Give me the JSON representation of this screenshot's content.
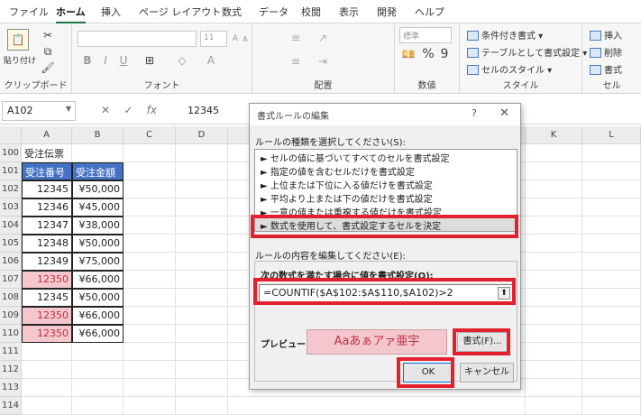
{
  "ribbon": {
    "tabs": [
      "ファイル",
      "ホーム",
      "挿入",
      "ページ レイアウト",
      "数式",
      "データ",
      "校閲",
      "表示",
      "開発",
      "ヘルプ"
    ],
    "clipboard": {
      "paste": "貼り付け",
      "label": "クリップボード"
    },
    "font": {
      "size": "11",
      "label": "フォント"
    },
    "alignment": {
      "label": "配置"
    },
    "number": {
      "format": "標準",
      "label": "数値"
    },
    "styles": {
      "conditional": "条件付き書式",
      "table": "テーブルとして書式設定",
      "cell": "セルのスタイル",
      "label": "スタイル"
    },
    "cells": {
      "insert": "挿入",
      "delete": "削除",
      "format": "書式",
      "label": "セル"
    }
  },
  "formula_bar": {
    "name_box": "A102",
    "value": "12345",
    "fx": "fx"
  },
  "grid": {
    "columns": [
      "A",
      "B",
      "C",
      "D",
      "K",
      "L"
    ],
    "rows": [
      {
        "num": "100",
        "a": "受注伝票",
        "b": ""
      },
      {
        "num": "101",
        "a": "受注番号",
        "b": "受注金額"
      },
      {
        "num": "102",
        "a": "12345",
        "b": "¥50,000"
      },
      {
        "num": "103",
        "a": "12346",
        "b": "¥45,000"
      },
      {
        "num": "104",
        "a": "12347",
        "b": "¥38,000"
      },
      {
        "num": "105",
        "a": "12348",
        "b": "¥50,000"
      },
      {
        "num": "106",
        "a": "12349",
        "b": "¥75,000"
      },
      {
        "num": "107",
        "a": "12350",
        "b": "¥66,000"
      },
      {
        "num": "108",
        "a": "12345",
        "b": "¥50,000"
      },
      {
        "num": "109",
        "a": "12350",
        "b": "¥66,000"
      },
      {
        "num": "110",
        "a": "12350",
        "b": "¥66,000"
      },
      {
        "num": "111",
        "a": "",
        "b": ""
      },
      {
        "num": "112",
        "a": "",
        "b": ""
      },
      {
        "num": "113",
        "a": "",
        "b": ""
      },
      {
        "num": "114",
        "a": "",
        "b": ""
      }
    ]
  },
  "dialog": {
    "title": "書式ルールの編集",
    "help": "?",
    "close": "✕",
    "rule_type_label": "ルールの種類を選択してください(S):",
    "rule_types": [
      "► セルの値に基づいてすべてのセルを書式設定",
      "► 指定の値を含むセルだけを書式設定",
      "► 上位または下位に入る値だけを書式設定",
      "► 平均より上または下の値だけを書式設定",
      "► 一意の値または重複する値だけを書式設定",
      "► 数式を使用して、書式設定するセルを決定"
    ],
    "edit_label": "ルールの内容を編集してください(E):",
    "formula_label": "次の数式を満たす場合に値を書式設定(O):",
    "formula": "=COUNTIF($A$102:$A$110,$A102)>2",
    "preview_label": "プレビュー:",
    "preview_text": "Aaあぁアァ亜宇",
    "format_button": "書式(F)...",
    "ok": "OK",
    "cancel": "キャンセル"
  }
}
